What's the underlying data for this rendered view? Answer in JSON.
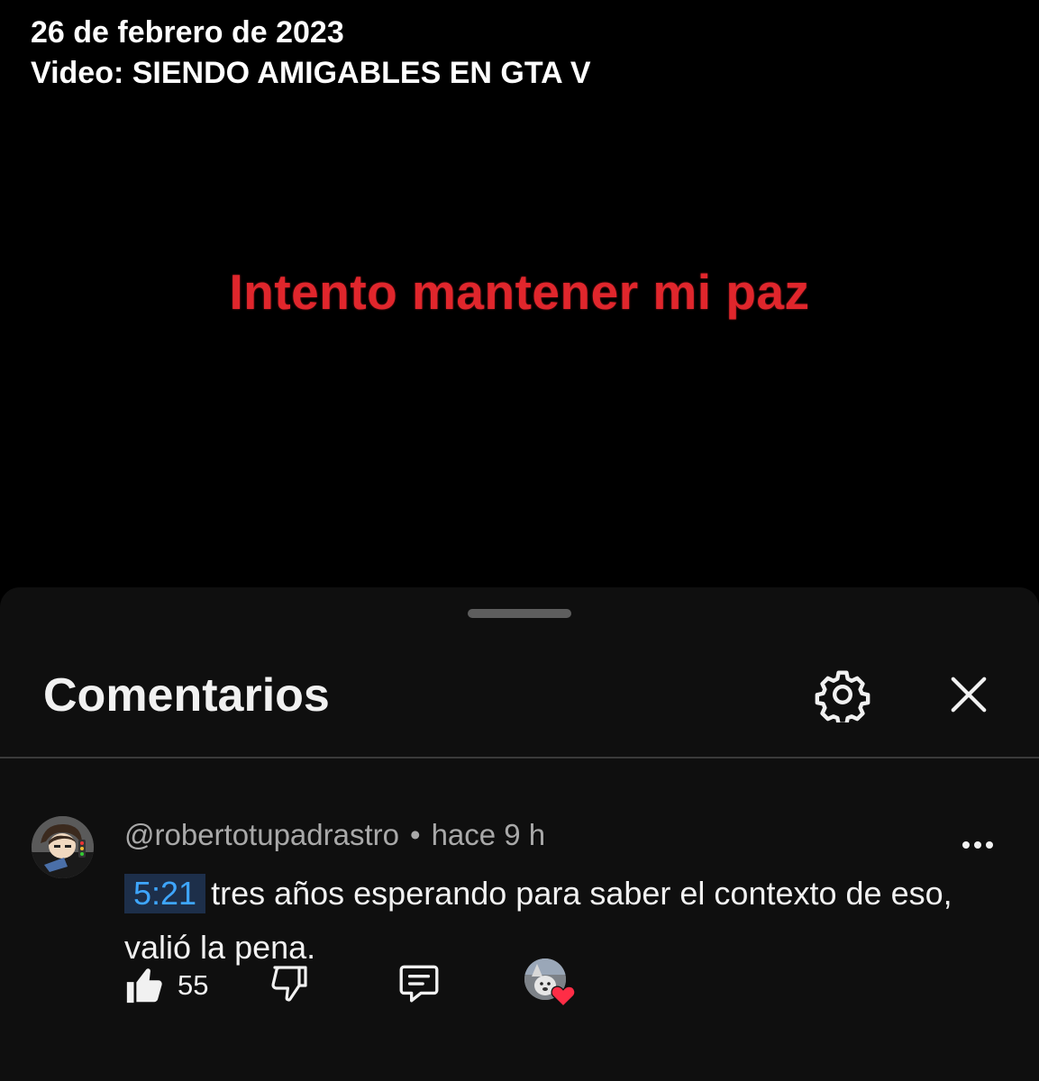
{
  "video": {
    "date": "26 de febrero de 2023",
    "title": "Video: SIENDO AMIGABLES EN GTA V",
    "caption": "Intento mantener mi paz"
  },
  "comments_panel": {
    "title": "Comentarios",
    "settings_icon": "gear-icon",
    "close_icon": "close-icon"
  },
  "comment": {
    "author": "@robertotupadrastro",
    "separator": "•",
    "time": "hace 9 h",
    "timestamp": "5:21",
    "text": "tres años esperando para saber el contexto de eso, valió la pena.",
    "like_count": "55",
    "more_icon": "more-dots-icon"
  },
  "colors": {
    "caption": "#e0262c",
    "link": "#3ea6ff",
    "sheet_bg": "#0f0f0f",
    "heart": "#ff2d46"
  }
}
